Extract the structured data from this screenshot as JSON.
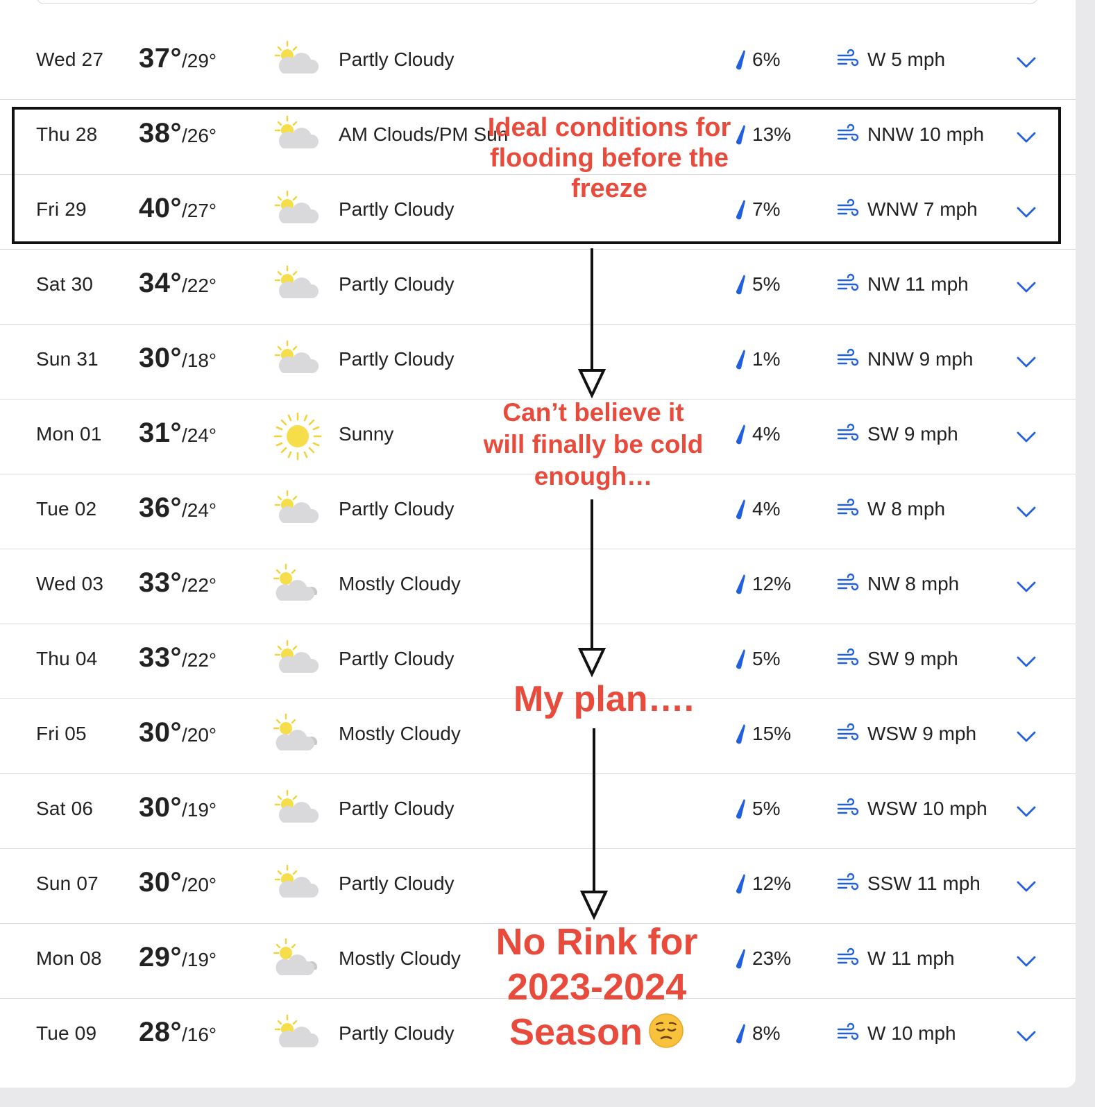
{
  "forecast": [
    {
      "day": "Wed 27",
      "hi": "37°",
      "lo": "/29°",
      "icon": "partly-cloudy-icon",
      "cond": "Partly Cloudy",
      "precip": "6%",
      "wind": "W 5 mph"
    },
    {
      "day": "Thu 28",
      "hi": "38°",
      "lo": "/26°",
      "icon": "partly-cloudy-icon",
      "cond": "AM Clouds/PM Sun",
      "precip": "13%",
      "wind": "NNW 10 mph"
    },
    {
      "day": "Fri 29",
      "hi": "40°",
      "lo": "/27°",
      "icon": "partly-cloudy-icon",
      "cond": "Partly Cloudy",
      "precip": "7%",
      "wind": "WNW 7 mph"
    },
    {
      "day": "Sat 30",
      "hi": "34°",
      "lo": "/22°",
      "icon": "partly-cloudy-icon",
      "cond": "Partly Cloudy",
      "precip": "5%",
      "wind": "NW 11 mph"
    },
    {
      "day": "Sun 31",
      "hi": "30°",
      "lo": "/18°",
      "icon": "partly-cloudy-icon",
      "cond": "Partly Cloudy",
      "precip": "1%",
      "wind": "NNW 9 mph"
    },
    {
      "day": "Mon 01",
      "hi": "31°",
      "lo": "/24°",
      "icon": "sun-icon",
      "cond": "Sunny",
      "precip": "4%",
      "wind": "SW 9 mph"
    },
    {
      "day": "Tue 02",
      "hi": "36°",
      "lo": "/24°",
      "icon": "partly-cloudy-icon",
      "cond": "Partly Cloudy",
      "precip": "4%",
      "wind": "W 8 mph"
    },
    {
      "day": "Wed 03",
      "hi": "33°",
      "lo": "/22°",
      "icon": "mostly-cloudy-icon",
      "cond": "Mostly Cloudy",
      "precip": "12%",
      "wind": "NW 8 mph"
    },
    {
      "day": "Thu 04",
      "hi": "33°",
      "lo": "/22°",
      "icon": "partly-cloudy-icon",
      "cond": "Partly Cloudy",
      "precip": "5%",
      "wind": "SW 9 mph"
    },
    {
      "day": "Fri 05",
      "hi": "30°",
      "lo": "/20°",
      "icon": "mostly-cloudy-icon",
      "cond": "Mostly Cloudy",
      "precip": "15%",
      "wind": "WSW 9 mph"
    },
    {
      "day": "Sat 06",
      "hi": "30°",
      "lo": "/19°",
      "icon": "partly-cloudy-icon",
      "cond": "Partly Cloudy",
      "precip": "5%",
      "wind": "WSW 10 mph"
    },
    {
      "day": "Sun 07",
      "hi": "30°",
      "lo": "/20°",
      "icon": "partly-cloudy-icon",
      "cond": "Partly Cloudy",
      "precip": "12%",
      "wind": "SSW 11 mph"
    },
    {
      "day": "Mon 08",
      "hi": "29°",
      "lo": "/19°",
      "icon": "mostly-cloudy-icon",
      "cond": "Mostly Cloudy",
      "precip": "23%",
      "wind": "W 11 mph"
    },
    {
      "day": "Tue 09",
      "hi": "28°",
      "lo": "/16°",
      "icon": "partly-cloudy-icon",
      "cond": "Partly Cloudy",
      "precip": "8%",
      "wind": "W 10 mph"
    }
  ],
  "annotations": {
    "ideal": "Ideal conditions for flooding before the freeze",
    "cold": "Can’t believe it will finally be cold enough…",
    "plan": "My plan….",
    "no_rink": "No Rink for 2023-2024 Season",
    "no_rink_emoji": "pensive-face-emoji"
  },
  "colors": {
    "annotation": "#e84b3c",
    "accent_blue": "#1f5fe0",
    "text": "#222222",
    "divider": "#dcdce0"
  }
}
